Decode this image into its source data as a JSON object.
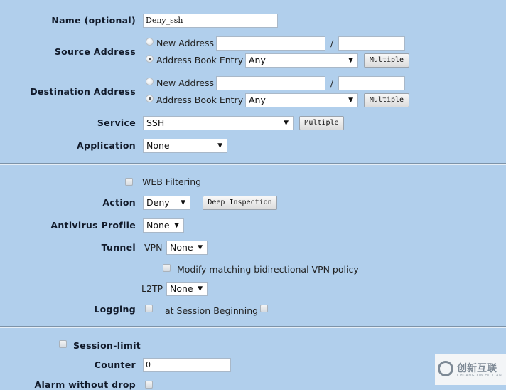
{
  "form": {
    "name": {
      "label": "Name (optional)",
      "value": "Deny_ssh"
    },
    "source": {
      "label": "Source Address",
      "new_address_label": "New Address",
      "address_book_label": "Address Book Entry",
      "address_value": "",
      "mask_value": "",
      "slash": "/",
      "address_book_value": "Any",
      "multiple_label": "Multiple",
      "selected": "address_book"
    },
    "destination": {
      "label": "Destination Address",
      "new_address_label": "New Address",
      "address_book_label": "Address Book Entry",
      "address_value": "",
      "mask_value": "",
      "slash": "/",
      "address_book_value": "Any",
      "multiple_label": "Multiple",
      "selected": "address_book"
    },
    "service": {
      "label": "Service",
      "value": "SSH",
      "multiple_label": "Multiple"
    },
    "application": {
      "label": "Application",
      "value": "None"
    },
    "web_filtering": {
      "label": "WEB Filtering",
      "checked": false
    },
    "action": {
      "label": "Action",
      "value": "Deny",
      "deep_inspection_label": "Deep Inspection"
    },
    "antivirus": {
      "label": "Antivirus Profile",
      "value": "None"
    },
    "tunnel": {
      "label": "Tunnel",
      "vpn_label": "VPN",
      "vpn_value": "None",
      "modify_label": "Modify matching bidirectional VPN policy",
      "l2tp_label": "L2TP",
      "l2tp_value": "None"
    },
    "logging": {
      "label": "Logging",
      "session_beginning_label": "at Session Beginning"
    },
    "session_limit": {
      "label": "Session-limit",
      "checked": false
    },
    "counter": {
      "label": "Counter",
      "value": "0"
    },
    "alarm": {
      "label": "Alarm without drop"
    }
  },
  "watermark": {
    "text": "创新互联",
    "subtext": "CHUANG XIN HU LIAN"
  }
}
